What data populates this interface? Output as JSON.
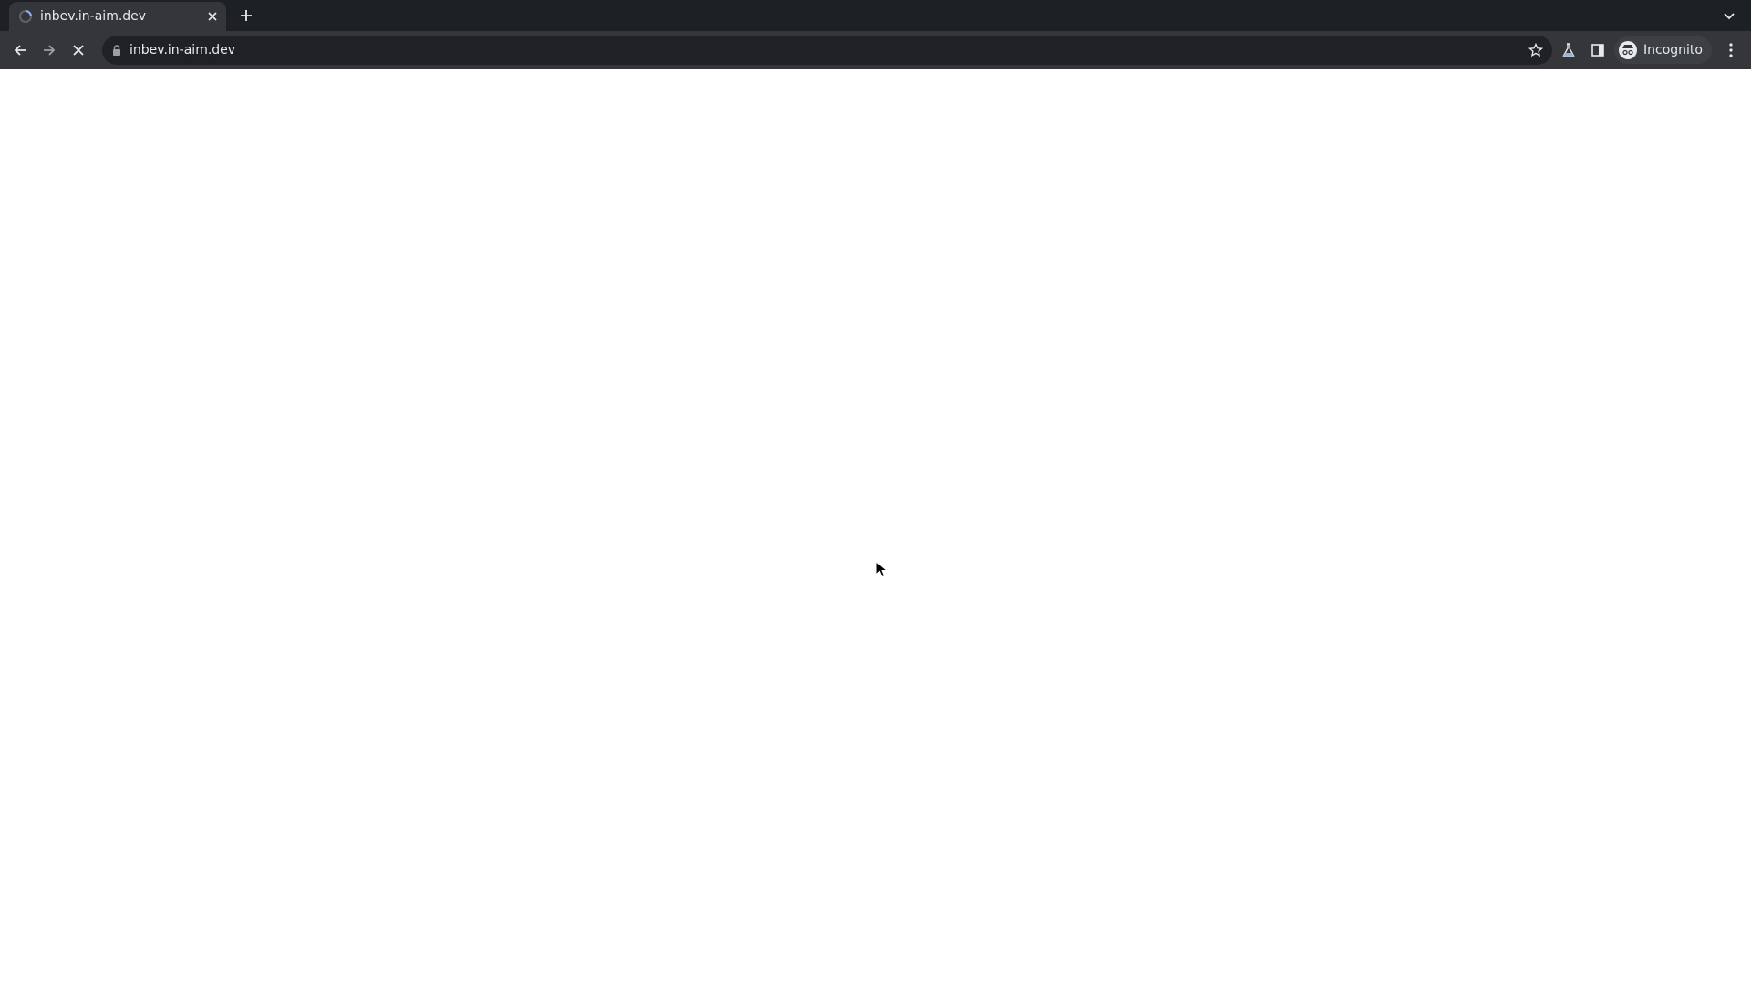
{
  "tab": {
    "title": "inbev.in-aim.dev",
    "favicon": "globe-spinner-icon",
    "close_icon": "close-icon"
  },
  "toolbar": {
    "url": "inbev.in-aim.dev",
    "incognito_label": "Incognito",
    "back_icon": "back-arrow-icon",
    "forward_icon": "forward-arrow-icon",
    "stop_icon": "stop-loading-icon",
    "lock_icon": "lock-icon",
    "bookmark_icon": "star-icon",
    "labs_icon": "flask-icon",
    "sidepanel_icon": "side-panel-icon",
    "menu_icon": "kebab-menu-icon"
  },
  "colors": {
    "tabstrip": "#1e2124",
    "toolbar": "#35363a",
    "omnibox": "#202124",
    "text": "#e8eaed",
    "content": "#ffffff"
  }
}
